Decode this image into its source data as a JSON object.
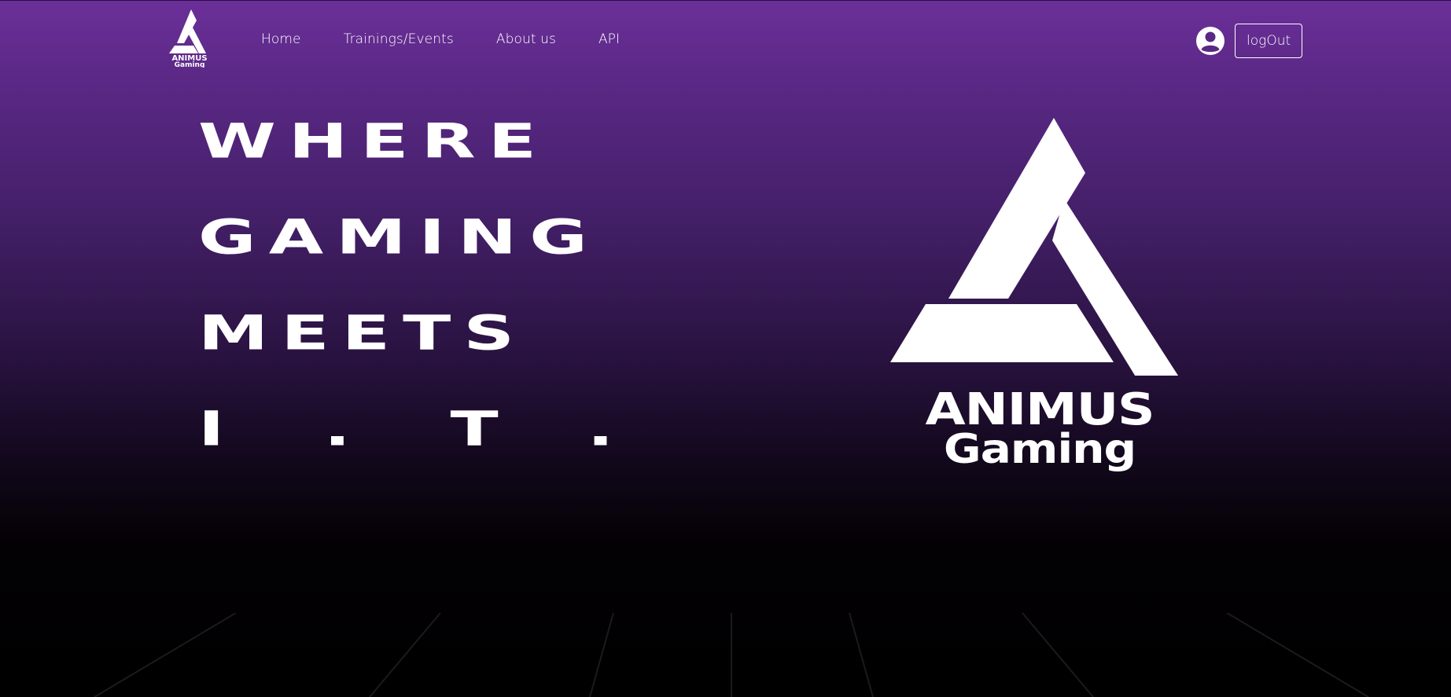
{
  "header": {
    "brand_logo_text_line1": "ANIMUS",
    "brand_logo_text_line2": "Gaming",
    "nav": [
      {
        "label": "Home"
      },
      {
        "label": "Trainings/Events"
      },
      {
        "label": "About us"
      },
      {
        "label": "API"
      }
    ],
    "user_icon": "user-circle-icon",
    "logout_label": "logOut"
  },
  "hero": {
    "lines": [
      "WHERE",
      "GAMING",
      "MEETS",
      "I.T."
    ]
  },
  "logo": {
    "line1": "ANIMUS",
    "line2": "Gaming"
  },
  "colors": {
    "accent_purple": "#6b2f99",
    "background_dark": "#000000",
    "text": "#ffffff"
  }
}
